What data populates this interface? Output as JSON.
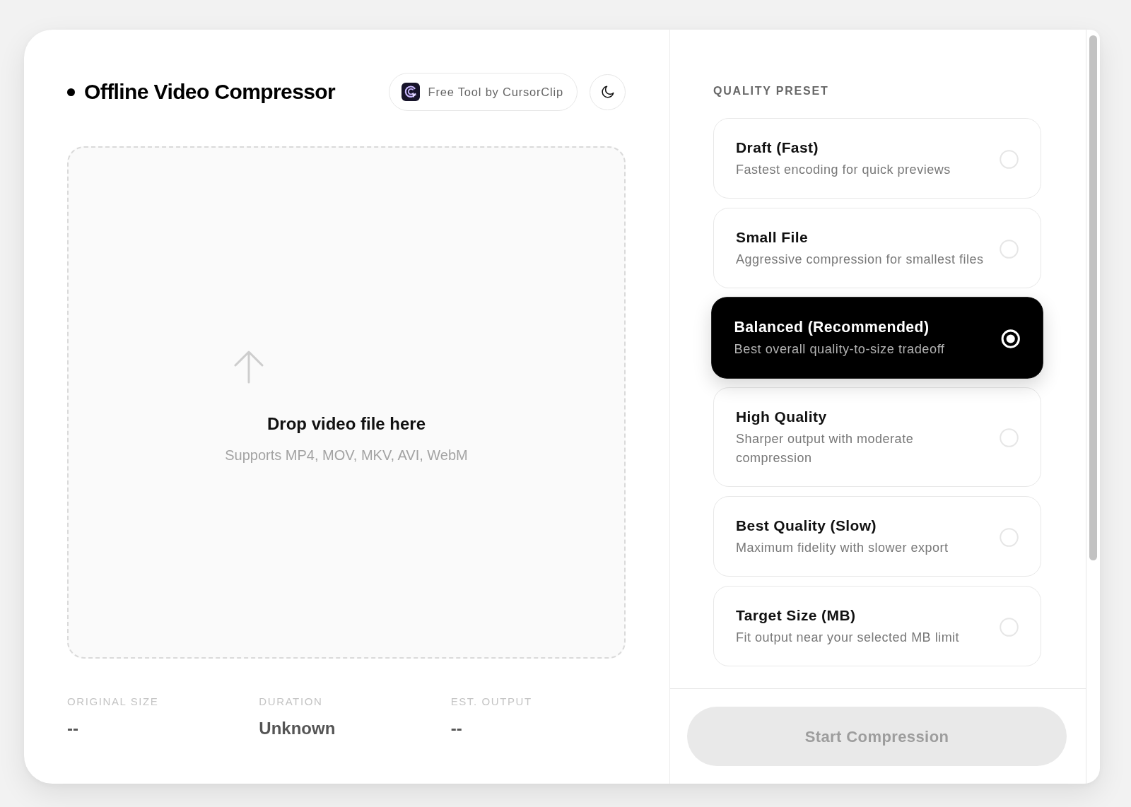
{
  "header": {
    "title": "Offline Video Compressor",
    "badge": {
      "label": "Free Tool by CursorClip"
    }
  },
  "drop_zone": {
    "title": "Drop video file here",
    "hint": "Supports MP4, MOV, MKV, AVI, WebM"
  },
  "stats": [
    {
      "label": "ORIGINAL SIZE",
      "value": "--"
    },
    {
      "label": "DURATION",
      "value": "Unknown"
    },
    {
      "label": "EST. OUTPUT",
      "value": "--"
    }
  ],
  "quality_preset": {
    "heading": "QUALITY PRESET",
    "options": [
      {
        "title": "Draft (Fast)",
        "description": "Fastest encoding for quick previews",
        "selected": false
      },
      {
        "title": "Small File",
        "description": "Aggressive compression for smallest files",
        "selected": false
      },
      {
        "title": "Balanced (Recommended)",
        "description": "Best overall quality-to-size tradeoff",
        "selected": true
      },
      {
        "title": "High Quality",
        "description": "Sharper output with moderate compression",
        "selected": false
      },
      {
        "title": "Best Quality (Slow)",
        "description": "Maximum fidelity with slower export",
        "selected": false
      },
      {
        "title": "Target Size (MB)",
        "description": "Fit output near your selected MB limit",
        "selected": false
      }
    ]
  },
  "start_button": {
    "label": "Start Compression",
    "disabled": true
  }
}
